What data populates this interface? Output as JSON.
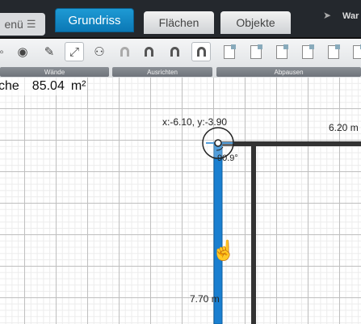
{
  "tabs": {
    "menu": "enü",
    "grundriss": "Grundriss",
    "flaechen": "Flächen",
    "objekte": "Objekte"
  },
  "header": {
    "user_label": "War"
  },
  "toolbar": {
    "sections": {
      "waende": "Wände",
      "ausrichten": "Ausrichten",
      "abpausen": "Abpausen"
    }
  },
  "canvas": {
    "area_label": "che",
    "area_value": "85.04",
    "area_unit": "m²",
    "coordinates": "x:-6.10,   y:-3.90",
    "angle": "90.9°",
    "dimension_top": "6.20  m",
    "dimension_vertical": "7.70   m"
  },
  "colors": {
    "accent_tab": "#0b78b5",
    "wall_active": "#1a7fd0",
    "wall_existing": "#333333"
  }
}
